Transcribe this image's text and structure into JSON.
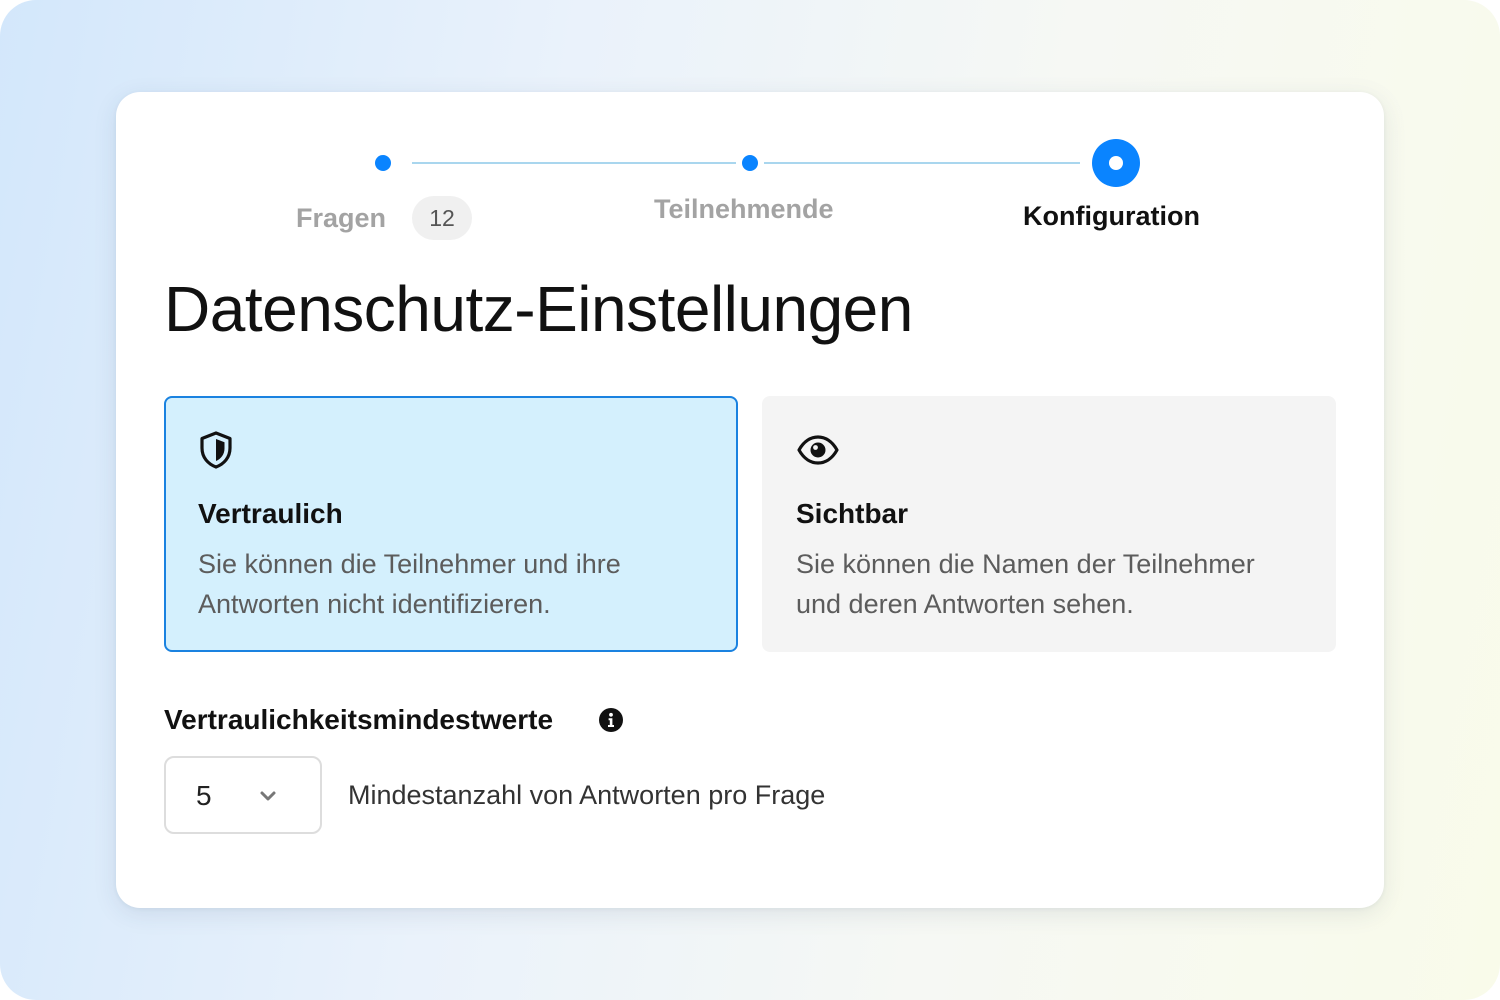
{
  "stepper": {
    "steps": [
      {
        "label": "Fragen",
        "badge": "12",
        "state": "completed"
      },
      {
        "label": "Teilnehmende",
        "state": "completed"
      },
      {
        "label": "Konfiguration",
        "state": "active"
      }
    ]
  },
  "page": {
    "title": "Datenschutz-Einstellungen"
  },
  "options": [
    {
      "id": "confidential",
      "icon": "shield-icon",
      "title": "Vertraulich",
      "description": "Sie können die Teilnehmer und ihre Antworten nicht identifizieren.",
      "selected": true
    },
    {
      "id": "visible",
      "icon": "eye-icon",
      "title": "Sichtbar",
      "description": "Sie können die Namen der Teilnehmer und deren Antworten sehen.",
      "selected": false
    }
  ],
  "threshold": {
    "label": "Vertraulichkeitsmindestwerte",
    "info_icon": "info-icon",
    "selected_value": "5",
    "caption": "Mindestanzahl von Antworten pro Frage"
  },
  "colors": {
    "accent": "#0a84ff",
    "selected_bg": "#d4f0fd",
    "selected_border": "#1a82e0",
    "unselected_bg": "#f4f4f4"
  }
}
